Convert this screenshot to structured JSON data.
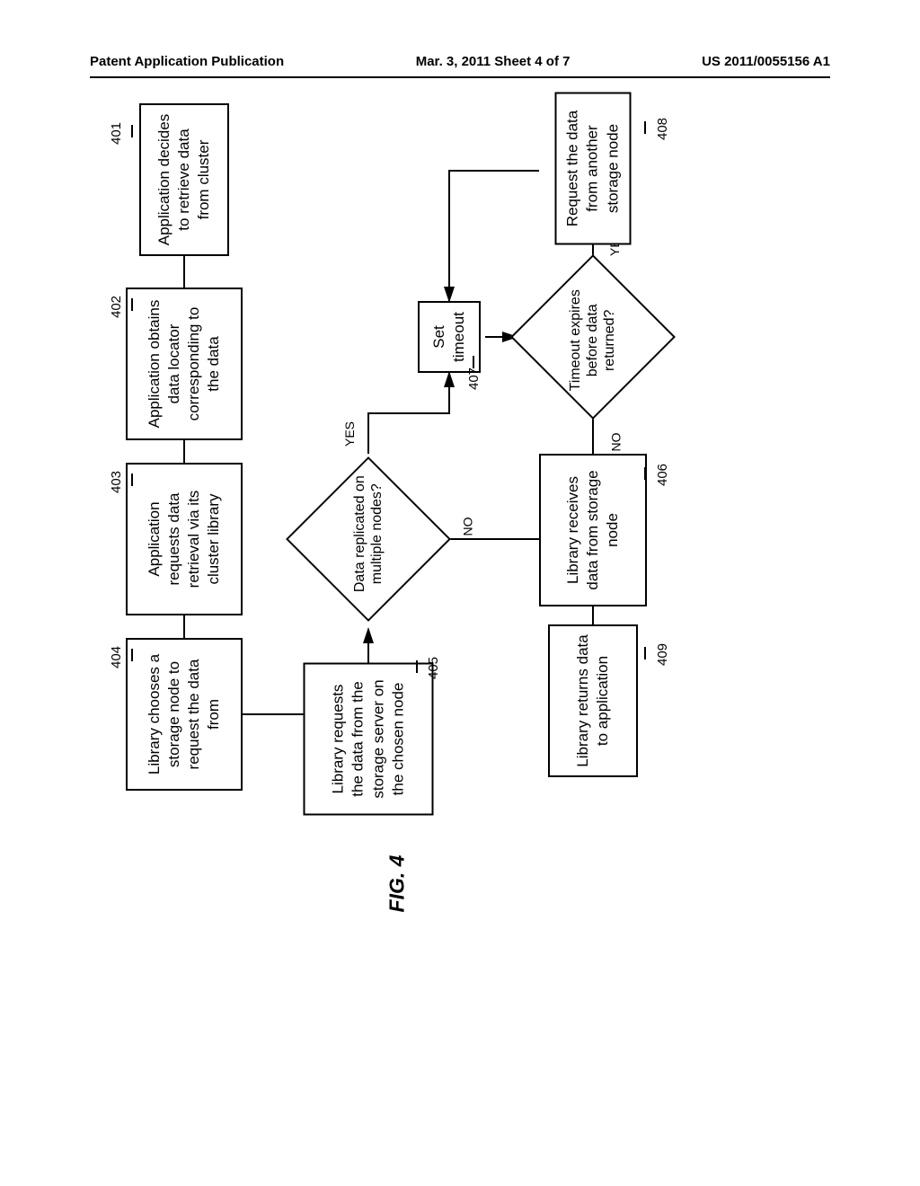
{
  "header": {
    "left": "Patent Application Publication",
    "center": "Mar. 3, 2011  Sheet 4 of 7",
    "right": "US 2011/0055156 A1"
  },
  "figure_label": "FIG. 4",
  "nodes": {
    "b401": {
      "ref": "401",
      "text": "Application decides to retrieve data from cluster"
    },
    "b402": {
      "ref": "402",
      "text": "Application obtains data locator corresponding to the data"
    },
    "b403": {
      "ref": "403",
      "text": "Application requests data retrieval via its cluster library"
    },
    "b404": {
      "ref": "404",
      "text": "Library chooses a storage node to request the data from"
    },
    "b405": {
      "ref": "405",
      "text": "Library requests the data from the storage server on the chosen node"
    },
    "b406": {
      "ref": "406",
      "text": "Library receives data from storage node"
    },
    "b407": {
      "ref": "407",
      "text": "Set timeout"
    },
    "b408": {
      "ref": "408",
      "text": "Request the data from another storage node"
    },
    "b409": {
      "ref": "409",
      "text": "Library returns data to application"
    },
    "d1": {
      "text": "Data replicated on multiple nodes?"
    },
    "d2": {
      "text": "Timeout expires before data returned?"
    }
  },
  "labels": {
    "yes": "YES",
    "no": "NO"
  },
  "chart_data": {
    "type": "flowchart",
    "orientation": "rotated-90-ccw",
    "nodes": [
      {
        "id": "401",
        "type": "process",
        "text": "Application decides to retrieve data from cluster"
      },
      {
        "id": "402",
        "type": "process",
        "text": "Application obtains data locator corresponding to the data"
      },
      {
        "id": "403",
        "type": "process",
        "text": "Application requests data retrieval via its cluster library"
      },
      {
        "id": "404",
        "type": "process",
        "text": "Library chooses a storage node to request the data from"
      },
      {
        "id": "405",
        "type": "process",
        "text": "Library requests the data from the storage server on the chosen node"
      },
      {
        "id": "D1",
        "type": "decision",
        "text": "Data replicated on multiple nodes?"
      },
      {
        "id": "407",
        "type": "process",
        "text": "Set timeout"
      },
      {
        "id": "D2",
        "type": "decision",
        "text": "Timeout expires before data returned?"
      },
      {
        "id": "408",
        "type": "process",
        "text": "Request the data from another storage node"
      },
      {
        "id": "406",
        "type": "process",
        "text": "Library receives data from storage node"
      },
      {
        "id": "409",
        "type": "process",
        "text": "Library returns data to application"
      }
    ],
    "edges": [
      {
        "from": "401",
        "to": "402"
      },
      {
        "from": "402",
        "to": "403"
      },
      {
        "from": "403",
        "to": "404"
      },
      {
        "from": "404",
        "to": "405"
      },
      {
        "from": "405",
        "to": "D1"
      },
      {
        "from": "D1",
        "to": "407",
        "label": "YES"
      },
      {
        "from": "D1",
        "to": "406",
        "label": "NO"
      },
      {
        "from": "407",
        "to": "D2"
      },
      {
        "from": "D2",
        "to": "408",
        "label": "YES"
      },
      {
        "from": "D2",
        "to": "406",
        "label": "NO"
      },
      {
        "from": "408",
        "to": "407"
      },
      {
        "from": "406",
        "to": "409"
      }
    ]
  }
}
